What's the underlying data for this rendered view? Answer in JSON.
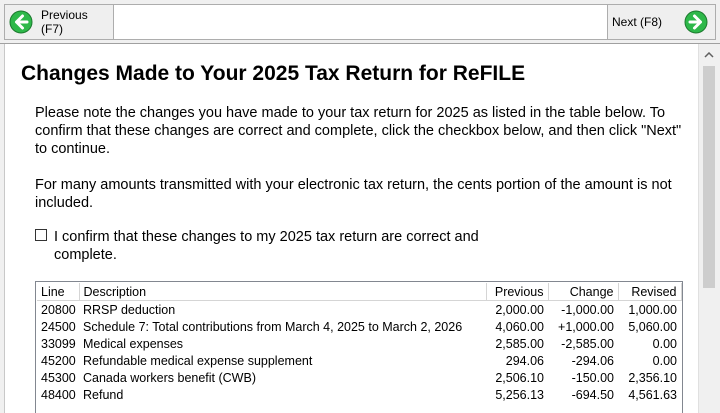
{
  "toolbar": {
    "previous_label": "Previous (F7)",
    "next_label": "Next (F8)",
    "accent_color": "#27a844"
  },
  "page": {
    "title": "Changes Made to Your 2025 Tax Return for ReFILE",
    "paragraph1": "Please note the changes you have made to your tax return for 2025 as listed in the table below. To confirm that these changes are correct and complete, click the checkbox below, and then click \"Next\" to continue.",
    "paragraph2": "For many amounts transmitted with your electronic tax return, the cents portion of the amount is not included.",
    "confirm_label": "I confirm that these changes to my 2025 tax return are correct and complete.",
    "confirm_checked": false
  },
  "table": {
    "headers": {
      "line": "Line",
      "description": "Description",
      "previous": "Previous",
      "change": "Change",
      "revised": "Revised"
    },
    "rows": [
      {
        "line": "20800",
        "description": "RRSP deduction",
        "previous": "2,000.00",
        "change": "-1,000.00",
        "revised": "1,000.00"
      },
      {
        "line": "24500",
        "description": "Schedule 7: Total contributions from March 4, 2025 to March 2, 2026",
        "previous": "4,060.00",
        "change": "+1,000.00",
        "revised": "5,060.00"
      },
      {
        "line": "33099",
        "description": "Medical expenses",
        "previous": "2,585.00",
        "change": "-2,585.00",
        "revised": "0.00"
      },
      {
        "line": "45200",
        "description": "Refundable medical expense supplement",
        "previous": "294.06",
        "change": "-294.06",
        "revised": "0.00"
      },
      {
        "line": "45300",
        "description": "Canada workers benefit (CWB)",
        "previous": "2,506.10",
        "change": "-150.00",
        "revised": "2,356.10"
      },
      {
        "line": "48400",
        "description": "Refund",
        "previous": "5,256.13",
        "change": "-694.50",
        "revised": "4,561.63"
      }
    ]
  }
}
